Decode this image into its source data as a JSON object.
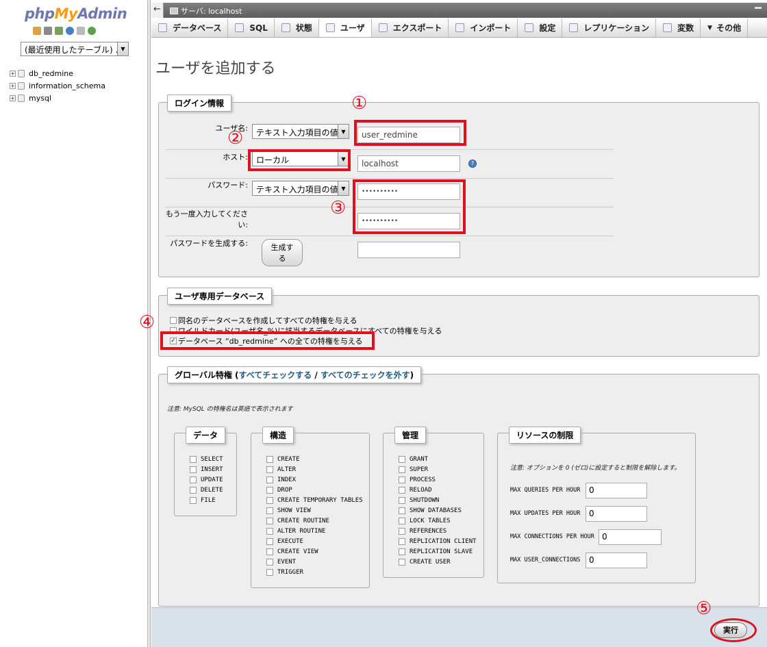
{
  "app": {
    "logo_php": "php",
    "logo_my": "My",
    "logo_admin": "Admin"
  },
  "nav": {
    "recent_tables": "(最近使用したテーブル) ...",
    "databases": [
      "db_redmine",
      "information_schema",
      "mysql"
    ]
  },
  "topbar": {
    "server_label": "サーバ: localhost"
  },
  "tabs": [
    "データベース",
    "SQL",
    "状態",
    "ユーザ",
    "エクスポート",
    "インポート",
    "設定",
    "レプリケーション",
    "変数",
    "その他"
  ],
  "page_title": "ユーザを追加する",
  "login": {
    "legend": "ログイン情報",
    "username_label": "ユーザ名:",
    "username_type": "テキスト入力項目の値",
    "username_value": "user_redmine",
    "host_label": "ホスト:",
    "host_type": "ローカル",
    "host_value": "localhost",
    "password_label": "パスワード:",
    "password_type": "テキスト入力項目の値",
    "password_value": "••••••••••",
    "retype_label": "もう一度入力してください:",
    "retype_value": "••••••••••",
    "generate_label": "パスワードを生成する:",
    "generate_button": "生成する"
  },
  "userdb": {
    "legend": "ユーザ専用データベース",
    "options": [
      {
        "label": "同名のデータベースを作成してすべての特権を与える",
        "checked": false
      },
      {
        "label": "ワイルドカード(ユーザ名_%)に該当するデータベースにすべての特権を与える",
        "checked": false
      },
      {
        "label": "データベース “db_redmine” への全ての特権を与える",
        "checked": true
      }
    ]
  },
  "global": {
    "legend_prefix": "グローバル特権 (",
    "check_all": "すべてチェックする",
    "sep": " / ",
    "uncheck_all": "すべてのチェックを外す",
    "legend_suffix": ")",
    "note": "注意: MySQL の特権名は英語で表示されます",
    "data_legend": "データ",
    "data_privs": [
      "SELECT",
      "INSERT",
      "UPDATE",
      "DELETE",
      "FILE"
    ],
    "structure_legend": "構造",
    "structure_privs": [
      "CREATE",
      "ALTER",
      "INDEX",
      "DROP",
      "CREATE TEMPORARY TABLES",
      "SHOW VIEW",
      "CREATE ROUTINE",
      "ALTER ROUTINE",
      "EXECUTE",
      "CREATE VIEW",
      "EVENT",
      "TRIGGER"
    ],
    "admin_legend": "管理",
    "admin_privs": [
      "GRANT",
      "SUPER",
      "PROCESS",
      "RELOAD",
      "SHUTDOWN",
      "SHOW DATABASES",
      "LOCK TABLES",
      "REFERENCES",
      "REPLICATION CLIENT",
      "REPLICATION SLAVE",
      "CREATE USER"
    ],
    "resource_legend": "リソースの制限",
    "resource_note": "注意: オプションを 0 (ゼロ)に設定すると制限を解除します。",
    "resources": [
      {
        "label": "MAX QUERIES PER HOUR",
        "value": "0"
      },
      {
        "label": "MAX UPDATES PER HOUR",
        "value": "0"
      },
      {
        "label": "MAX CONNECTIONS PER HOUR",
        "value": "0"
      },
      {
        "label": "MAX USER_CONNECTIONS",
        "value": "0"
      }
    ]
  },
  "execute_button": "実行",
  "annotations": [
    "①",
    "②",
    "③",
    "④",
    "⑤"
  ],
  "colors": {
    "annotation_red": "#e0101f",
    "logo_blue": "#6c78af",
    "logo_orange": "#f89c0e"
  }
}
